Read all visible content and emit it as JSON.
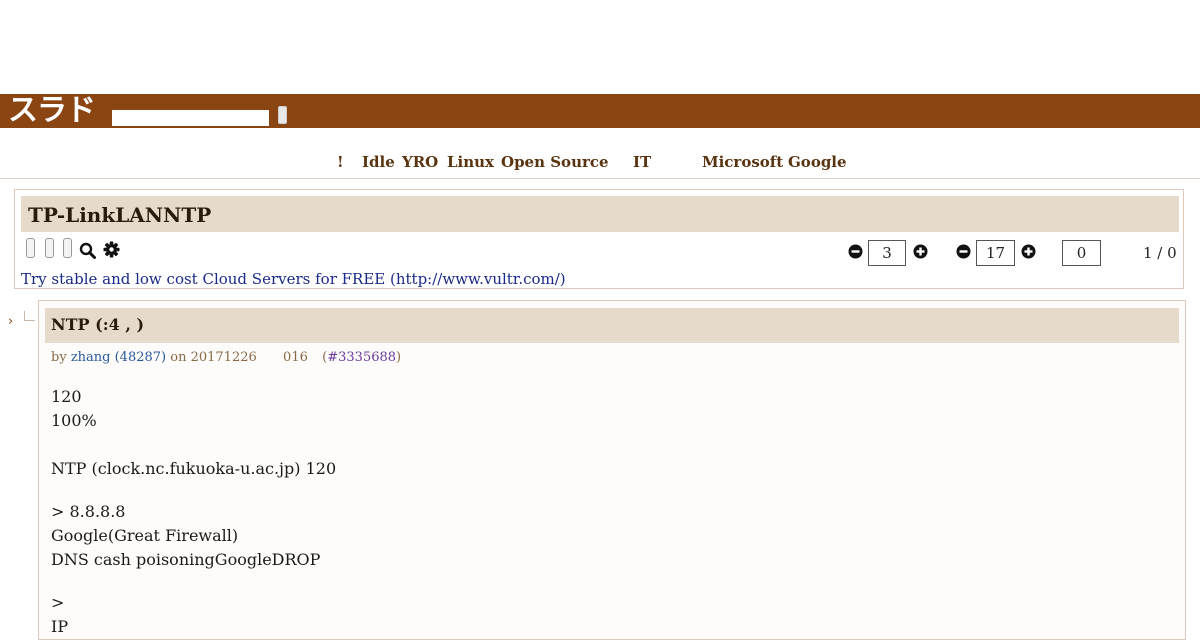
{
  "header": {
    "logo_text": "スラド",
    "search_placeholder": "",
    "search_button_label": ""
  },
  "nav": {
    "items": [
      "!",
      "Idle",
      "YRO",
      "Linux",
      "Open Source",
      "IT",
      "Microsoft",
      "Google"
    ]
  },
  "story": {
    "title": "TP-LinkLANNTP",
    "threshold_value": "3",
    "comment_value": "17",
    "third_value": "0",
    "page_count": "1 / 0",
    "ad_text": "Try stable and low cost Cloud Servers for FREE (http://www.vultr.com/)"
  },
  "comment": {
    "title": "NTP (:4  , )",
    "meta_by": "by",
    "meta_user": "zhang (48287)",
    "meta_on": "on 20171226",
    "meta_time": "016",
    "meta_cid": "#3335688",
    "lines": [
      "120",
      "100%",
      "NTP (clock.nc.fukuoka-u.ac.jp) 120",
      "> 8.8.8.8",
      "Google(Great Firewall)",
      "DNS cash poisoningGoogleDROP",
      ">",
      "IP"
    ]
  },
  "colors": {
    "brand": "#8b4513",
    "title_bar": "#e6dacb",
    "nav_text": "#5a3410",
    "link": "#1a2a8a"
  },
  "icons": [
    "search-icon",
    "gear-icon",
    "minus-circle-icon",
    "plus-circle-icon",
    "caret-right-icon"
  ]
}
